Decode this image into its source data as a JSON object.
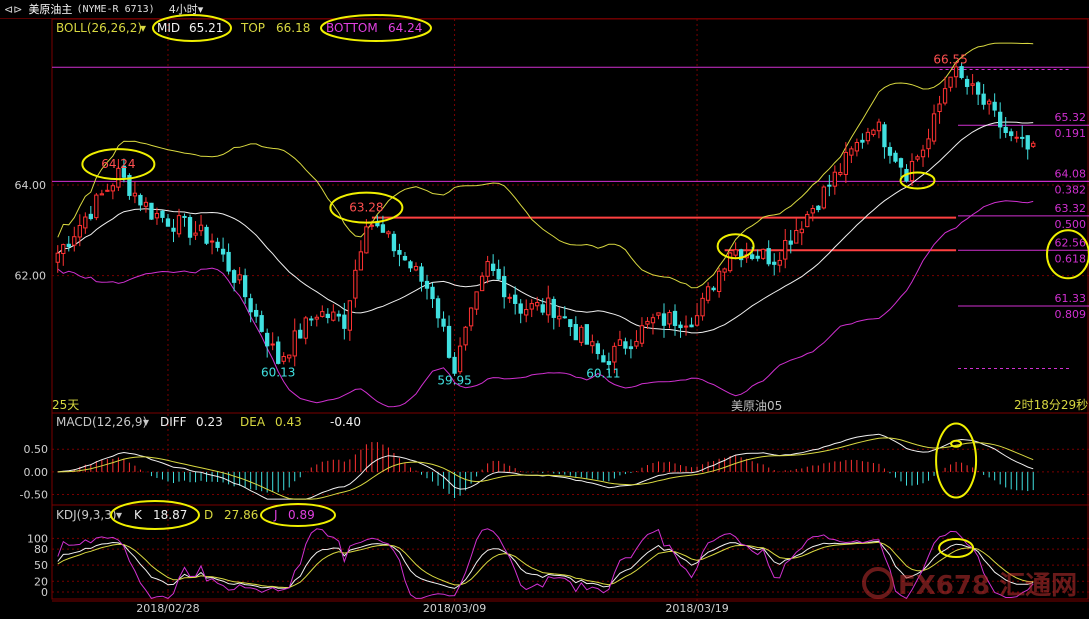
{
  "header": {
    "icon": "back-arrows-icon",
    "name": "美原油主",
    "code": "(NYME-R 6713)",
    "period": "4小时",
    "period_caret": "▾"
  },
  "boll": {
    "label": "BOLL(26,26,2)",
    "caret": "▾",
    "mid_label": "MID",
    "mid_value": "65.21",
    "top_label": "TOP",
    "top_value": "66.18",
    "bottom_label": "BOTTOM",
    "bottom_value": "64.24"
  },
  "macd": {
    "label": "MACD(12,26,9)",
    "caret": "▾",
    "diff_label": "DIFF",
    "diff_value": "0.23",
    "dea_label": "DEA",
    "dea_value": "0.43",
    "macd_value": "-0.40"
  },
  "kdj": {
    "label": "KDJ(9,3,3)",
    "caret": "▾",
    "k_label": "K",
    "k_value": "18.87",
    "d_label": "D",
    "d_value": "27.86",
    "j_label": "J",
    "j_value": "0.89"
  },
  "footer": {
    "left": "25天",
    "center": "美原油05",
    "right": "2时18分29秒"
  },
  "watermark": "FX678 汇通网",
  "colors": {
    "up": "#ff3232",
    "down": "#40e0e0",
    "top_band": "#d8d840",
    "mid_band": "#f0f0f0",
    "bottom_band": "#d030d0",
    "fib": "#d030d0",
    "red_level": "#ff4040",
    "highlight": "#f0f000",
    "grid": "#7a0000"
  },
  "chart_data": [
    {
      "type": "candlestick",
      "title": "美原油主 (NYME-R 6713) 4小时",
      "ylim": [
        59.3,
        67.2
      ],
      "y_ticks": [
        62.0,
        64.0
      ],
      "x_tick_labels": [
        {
          "label": "2018/02/28",
          "index": 20
        },
        {
          "label": "2018/03/09",
          "index": 72
        },
        {
          "label": "2018/03/19",
          "index": 116
        }
      ],
      "series": [
        {
          "name": "TOP"
        },
        {
          "name": "MID"
        },
        {
          "name": "BOTTOM"
        }
      ],
      "price_annotations": [
        {
          "label": "64.24",
          "index": 11,
          "value": 64.24,
          "circled": true
        },
        {
          "label": "63.28",
          "index": 56,
          "value": 63.28,
          "circled": true
        },
        {
          "label": "60.13",
          "index": 40,
          "value": 60.13
        },
        {
          "label": "59.95",
          "index": 72,
          "value": 59.95
        },
        {
          "label": "60.11",
          "index": 99,
          "value": 60.11
        },
        {
          "label": "66.55",
          "index": 162,
          "value": 66.55
        }
      ],
      "fib_levels": [
        {
          "price": "65.32",
          "ratio": "0.191",
          "value": 65.32
        },
        {
          "price": "64.08",
          "ratio": "0.382",
          "value": 64.08
        },
        {
          "price": "63.32",
          "ratio": "0.500",
          "value": 63.32
        },
        {
          "price": "62.56",
          "ratio": "0.618",
          "value": 62.56,
          "circled": true
        },
        {
          "price": "61.33",
          "ratio": "0.809",
          "value": 61.33
        }
      ],
      "key_levels": {
        "top_line": 66.6,
        "mid_line": 64.08,
        "red_levels": [
          63.28,
          62.56
        ],
        "dotted_high": 66.55,
        "dotted_low": 59.95
      },
      "candle_count": 178
    },
    {
      "type": "macd",
      "y_tick_labels": [
        "0.50",
        "0.00",
        "-0.50"
      ],
      "y_ticks": [
        0.5,
        0.0,
        -0.5
      ],
      "ylim": [
        -0.62,
        0.88
      ]
    },
    {
      "type": "kdj",
      "y_tick_labels": [
        "100",
        "80",
        "50",
        "20",
        "0"
      ],
      "y_ticks": [
        100,
        80,
        50,
        20,
        0
      ],
      "ylim": [
        -15,
        125
      ]
    }
  ]
}
